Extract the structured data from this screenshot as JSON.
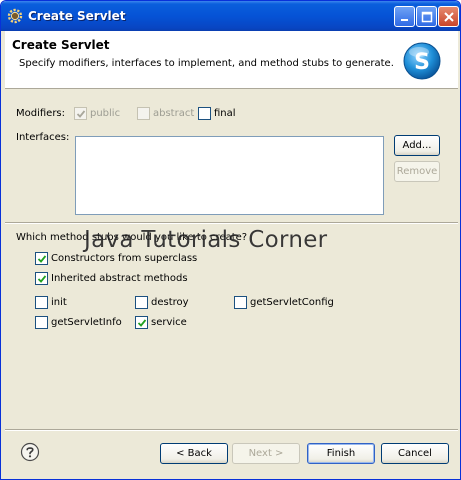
{
  "window": {
    "title": "Create Servlet"
  },
  "banner": {
    "title": "Create Servlet",
    "description": "Specify modifiers, interfaces to implement, and method stubs to generate.",
    "logo_letter": "S"
  },
  "modifiers": {
    "label": "Modifiers:",
    "public": {
      "label": "public",
      "checked": true,
      "enabled": false
    },
    "abstract": {
      "label": "abstract",
      "checked": false,
      "enabled": false
    },
    "final": {
      "label": "final",
      "checked": false,
      "enabled": true
    }
  },
  "interfaces": {
    "label": "Interfaces:",
    "add_label": "Add...",
    "remove_label": "Remove"
  },
  "methods": {
    "prompt": "Which method stubs would you like to create?",
    "constructors": {
      "label": "Constructors from superclass",
      "checked": true
    },
    "inherited": {
      "label": "Inherited abstract methods",
      "checked": true
    },
    "init": {
      "label": "init",
      "checked": false
    },
    "destroy": {
      "label": "destroy",
      "checked": false
    },
    "getServletConfig": {
      "label": "getServletConfig",
      "checked": false
    },
    "getServletInfo": {
      "label": "getServletInfo",
      "checked": false
    },
    "service": {
      "label": "service",
      "checked": true
    }
  },
  "watermark": "Java Tutorials Corner",
  "footer": {
    "back_label": "< Back",
    "next_label": "Next >",
    "finish_label": "Finish",
    "cancel_label": "Cancel"
  },
  "colors": {
    "titlebar": "#0553d6",
    "dialog_bg": "#ece9d8",
    "logo": "#1f8fd8"
  }
}
